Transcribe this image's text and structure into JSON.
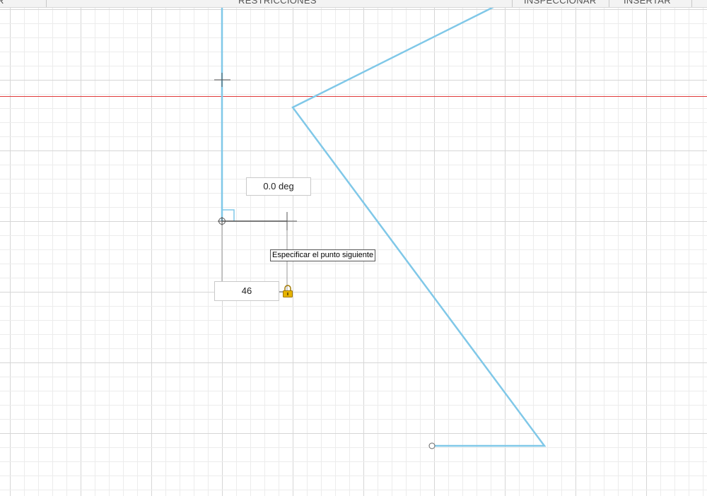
{
  "toolbar": {
    "items": [
      "R",
      "RESTRICCIONES",
      "INSPECCIONAR",
      "INSERTAR"
    ]
  },
  "sketch": {
    "angle_input_value": "0.0 deg",
    "length_input_value": "46",
    "tooltip_text": "Especificar el punto siguiente",
    "lock_icon": "padlock-icon"
  },
  "colors": {
    "sketch_line": "#80c8e8",
    "axis_line": "#e03a3a",
    "grid_minor": "#ececec",
    "grid_major": "#d6d6d6",
    "dimension_line": "#555555",
    "lock": "#e6b400"
  }
}
